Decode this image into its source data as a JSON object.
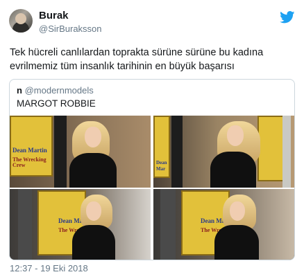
{
  "user": {
    "display_name": "Burak",
    "handle": "@SirBuraksson"
  },
  "tweet": {
    "text": "Tek hücreli canlılardan toprakta sürüne sürüne bu kadına evrilmemiz tüm insanlık tarihinin en büyük başarısı",
    "timestamp": "12:37 - 19 Eki 2018"
  },
  "quoted": {
    "name": "n",
    "handle": "@modernmodels",
    "text": "MARGOT ROBBIE",
    "poster_text_1": "Dean Martin",
    "poster_text_2": "The Wrecking Crew",
    "poster_text_3": "Dean Mar",
    "poster_text_4": "The Wre"
  },
  "icons": {
    "brand": "twitter-bird-icon",
    "brand_color": "#1da1f2"
  }
}
